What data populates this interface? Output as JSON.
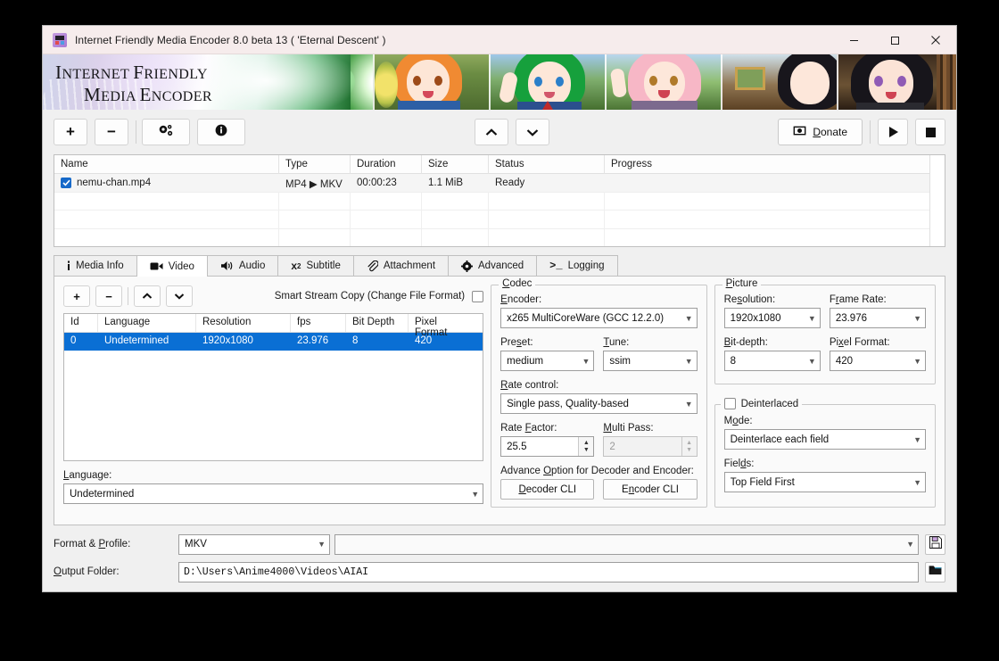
{
  "window": {
    "title": "Internet Friendly Media Encoder 8.0 beta 13 ( 'Eternal Descent' )",
    "icon": "app-icon",
    "minimize": "minimize-icon",
    "maximize": "maximize-icon",
    "close": "close-icon"
  },
  "banner": {
    "line1": "Internet Friendly",
    "line2": "Media Encoder"
  },
  "toolbar": {
    "add": "+",
    "remove": "−",
    "settings": "settings-icon",
    "info": "info-icon",
    "move_up": "∧",
    "move_down": "∨",
    "donate": "Donate",
    "donate_accesskey": "D",
    "play": "▶",
    "stop": "■"
  },
  "file_list": {
    "columns": [
      "Name",
      "Type",
      "Duration",
      "Size",
      "Status",
      "Progress"
    ],
    "rows": [
      {
        "checked": true,
        "name": "nemu-chan.mp4",
        "type": "MP4 ▶ MKV",
        "duration": "00:00:23",
        "size": "1.1 MiB",
        "status": "Ready",
        "progress": ""
      }
    ]
  },
  "tabs": [
    {
      "label": "Media Info",
      "icon": "info-icon",
      "active": false
    },
    {
      "label": "Video",
      "icon": "video-camera-icon",
      "active": true
    },
    {
      "label": "Audio",
      "icon": "speaker-icon",
      "active": false
    },
    {
      "label": "Subtitle",
      "icon": "subtitle-icon",
      "active": false
    },
    {
      "label": "Attachment",
      "icon": "paperclip-icon",
      "active": false
    },
    {
      "label": "Advanced",
      "icon": "gear-icon",
      "active": false
    },
    {
      "label": "Logging",
      "icon": "terminal-icon",
      "active": false
    }
  ],
  "video_tab": {
    "track_toolbar": {
      "add": "+",
      "remove": "−",
      "up": "∧",
      "down": "∨",
      "smart_stream_copy_label": "Smart Stream Copy (Change File Format)",
      "smart_stream_copy_checked": false
    },
    "track_table": {
      "columns": [
        "Id",
        "Language",
        "Resolution",
        "fps",
        "Bit Depth",
        "Pixel Format"
      ],
      "rows": [
        {
          "id": "0",
          "language": "Undetermined",
          "resolution": "1920x1080",
          "fps": "23.976",
          "bit_depth": "8",
          "pixel_format": "420",
          "selected": true
        }
      ]
    },
    "language": {
      "label": "Language:",
      "value": "Undetermined"
    },
    "codec": {
      "title": "Codec",
      "encoder_label": "Encoder:",
      "encoder_value": "x265 MultiCoreWare (GCC 12.2.0)",
      "preset_label": "Preset:",
      "preset_value": "medium",
      "tune_label": "Tune:",
      "tune_value": "ssim",
      "rate_control_label": "Rate control:",
      "rate_control_value": "Single pass, Quality-based",
      "rate_factor_label": "Rate Factor:",
      "rate_factor_value": "25.5",
      "multi_pass_label": "Multi Pass:",
      "multi_pass_value": "2",
      "multi_pass_enabled": false,
      "advance_option_label": "Advance Option for Decoder and Encoder:",
      "decoder_cli": "Decoder CLI",
      "encoder_cli": "Encoder CLI"
    },
    "picture": {
      "title": "Picture",
      "resolution_label": "Resolution:",
      "resolution_value": "1920x1080",
      "frame_rate_label": "Frame Rate:",
      "frame_rate_value": "23.976",
      "bit_depth_label": "Bit-depth:",
      "bit_depth_value": "8",
      "pixel_format_label": "Pixel Format:",
      "pixel_format_value": "420"
    },
    "deinterlaced": {
      "title": "Deinterlaced",
      "checked": false,
      "mode_label": "Mode:",
      "mode_value": "Deinterlace each field",
      "fields_label": "Fields:",
      "fields_value": "Top Field First"
    }
  },
  "bottom": {
    "format_profile_label": "Format & Profile:",
    "format_value": "MKV",
    "profile_value": "",
    "save_icon": "save-icon",
    "output_folder_label": "Output Folder:",
    "output_folder_value": "D:\\Users\\Anime4000\\Videos\\AIAI",
    "browse_icon": "folder-icon"
  },
  "colors": {
    "accent": "#0a6fd4",
    "checkbox": "#1669c9",
    "window_bg": "#f0f0f0",
    "titlebar": "#f6ecec"
  }
}
